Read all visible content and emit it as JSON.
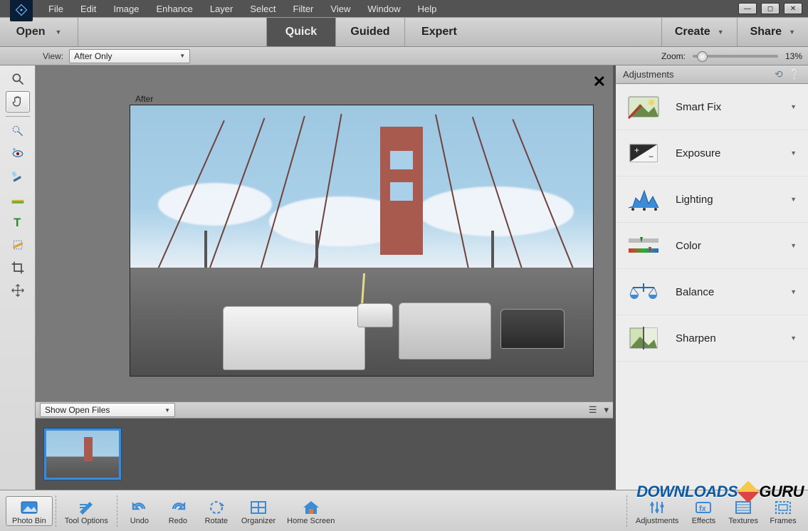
{
  "menu": [
    "File",
    "Edit",
    "Image",
    "Enhance",
    "Layer",
    "Select",
    "Filter",
    "View",
    "Window",
    "Help"
  ],
  "primary": {
    "open": "Open",
    "modes": [
      {
        "label": "Quick",
        "active": true
      },
      {
        "label": "Guided",
        "active": false
      },
      {
        "label": "Expert",
        "active": false
      }
    ],
    "create": "Create",
    "share": "Share"
  },
  "options": {
    "view_label": "View:",
    "view_value": "After Only",
    "zoom_label": "Zoom:",
    "zoom_value": "13%"
  },
  "canvas": {
    "after_label": "After"
  },
  "bin": {
    "dropdown": "Show Open Files"
  },
  "adjust": {
    "title": "Adjustments",
    "items": [
      "Smart Fix",
      "Exposure",
      "Lighting",
      "Color",
      "Balance",
      "Sharpen"
    ]
  },
  "taskbar": {
    "left": [
      "Photo Bin",
      "Tool Options"
    ],
    "mid": [
      "Undo",
      "Redo",
      "Rotate",
      "Organizer",
      "Home Screen"
    ],
    "right": [
      "Adjustments",
      "Effects",
      "Textures",
      "Frames"
    ]
  },
  "watermark": {
    "a": "DOWNLOADS",
    "b": "GURU"
  }
}
